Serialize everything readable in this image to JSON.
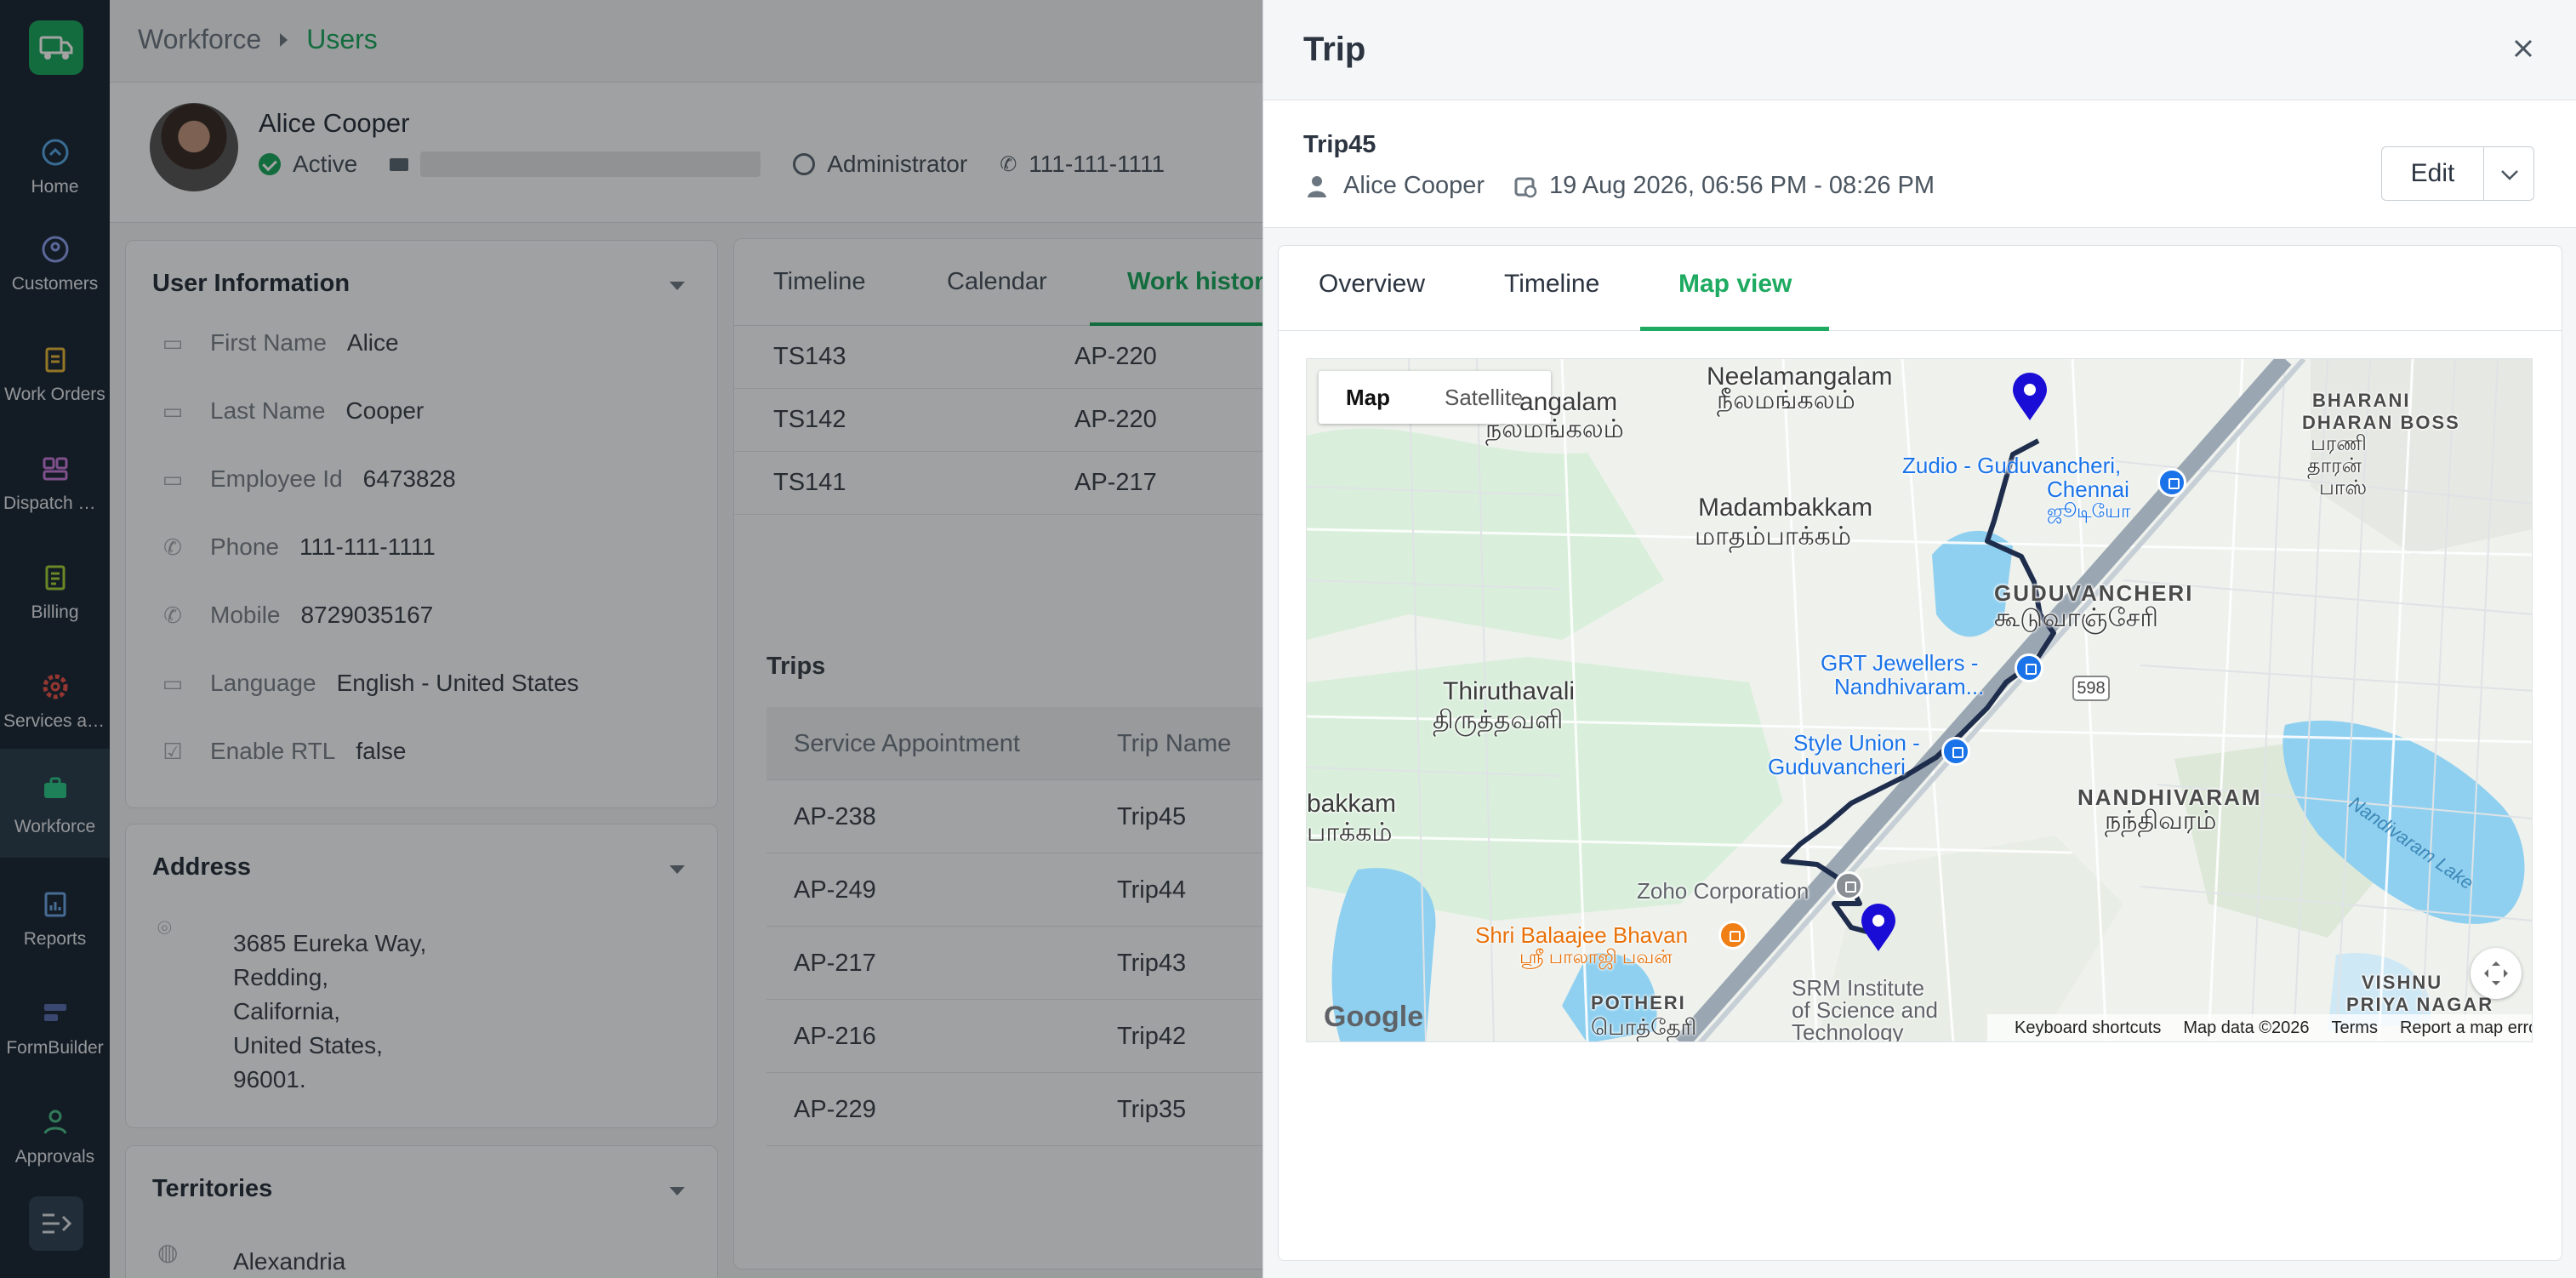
{
  "nav": {
    "items": [
      {
        "label": "Home",
        "icon": "home-icon"
      },
      {
        "label": "Customers",
        "icon": "customers-icon"
      },
      {
        "label": "Work Orders",
        "icon": "work-orders-icon"
      },
      {
        "label": "Dispatch Console",
        "icon": "dispatch-icon"
      },
      {
        "label": "Billing",
        "icon": "billing-icon"
      },
      {
        "label": "Services and Parts",
        "icon": "services-icon"
      },
      {
        "label": "Workforce",
        "icon": "workforce-icon"
      },
      {
        "label": "Reports",
        "icon": "reports-icon"
      },
      {
        "label": "FormBuilder",
        "icon": "formbuilder-icon"
      },
      {
        "label": "Approvals",
        "icon": "approvals-icon"
      }
    ],
    "active": "Workforce",
    "accent": "#1eaa61",
    "background": "#1f2d3b"
  },
  "breadcrumb": {
    "parent": "Workforce",
    "current": "Users"
  },
  "user": {
    "name": "Alice Cooper",
    "status": "Active",
    "role": "Administrator",
    "phone": "111-111-1111"
  },
  "user_info": {
    "title": "User Information",
    "rows": [
      {
        "label": "First Name",
        "value": "Alice"
      },
      {
        "label": "Last Name",
        "value": "Cooper"
      },
      {
        "label": "Employee Id",
        "value": "6473828"
      },
      {
        "label": "Phone",
        "value": "111-111-1111"
      },
      {
        "label": "Mobile",
        "value": "8729035167"
      },
      {
        "label": "Language",
        "value": "English - United States"
      },
      {
        "label": "Enable RTL",
        "value": "false"
      }
    ]
  },
  "address": {
    "title": "Address",
    "lines": [
      "3685 Eureka Way,",
      "Redding,",
      "California,",
      "United States,",
      "96001."
    ]
  },
  "territories": {
    "title": "Territories",
    "first": "Alexandria"
  },
  "work_panel": {
    "tabs": [
      "Timeline",
      "Calendar",
      "Work history"
    ],
    "active_tab": "Work history",
    "timesheets": [
      {
        "id": "TS143",
        "appointment": "AP-220"
      },
      {
        "id": "TS142",
        "appointment": "AP-220"
      },
      {
        "id": "TS141",
        "appointment": "AP-217"
      }
    ],
    "trips_title": "Trips",
    "trips_columns": [
      "Service Appointment",
      "Trip Name"
    ],
    "trips": [
      {
        "appointment": "AP-238",
        "trip": "Trip45"
      },
      {
        "appointment": "AP-249",
        "trip": "Trip44"
      },
      {
        "appointment": "AP-217",
        "trip": "Trip43"
      },
      {
        "appointment": "AP-216",
        "trip": "Trip42"
      },
      {
        "appointment": "AP-229",
        "trip": "Trip35"
      }
    ]
  },
  "drawer": {
    "title": "Trip",
    "trip_name": "Trip45",
    "owner": "Alice Cooper",
    "datetime": "19 Aug 2026, 06:56 PM - 08:26 PM",
    "edit_label": "Edit",
    "tabs": [
      "Overview",
      "Timeline",
      "Map view"
    ],
    "active_tab": "Map view"
  },
  "map": {
    "type_buttons": [
      "Map",
      "Satellite"
    ],
    "selected_type": "Map",
    "labels": {
      "neelamangalam": "Neelamangalam",
      "neelamangalam_ta": "நீலமங்கலம்",
      "nalamangalam_partial": "angalam",
      "nalamangalam_ta": "நலமங்கலம்",
      "madambakkam": "Madambakkam",
      "madambakkam_ta": "மாதம்பாக்கம்",
      "thiruthavali": "Thiruthavali",
      "thiruthavali_ta": "திருத்தவளி",
      "bakkam_partial": "bakkam",
      "bakkam_ta_partial": "பாக்கம்",
      "guduvancheri": "GUDUVANCHERI",
      "guduvancheri_ta": "கூடுவாஞ்சேரி",
      "nandhivaram": "NANDHIVARAM",
      "nandhivaram_ta": "நந்திவரம்",
      "bharani": "BHARANI",
      "bharani2": "DHARAN BOSS",
      "bharani_ta1": "பரணி",
      "bharani_ta2": "தாரன்",
      "bharani_ta3": "பாஸ்",
      "zudio": "Zudio - Guduvancheri,",
      "zudio2": "Chennai",
      "zudio_ta": "ஜூடியோ",
      "grt": "GRT Jewellers -",
      "grt2": "Nandhivaram...",
      "style_union": "Style Union -",
      "style_union2": "Guduvancheri",
      "zoho": "Zoho Corporation",
      "balaajee": "Shri Balaajee Bhavan",
      "balaajee_ta": "ஸ்ரீ பாலாஜி பவன்",
      "srm": "SRM Institute",
      "srm2": "of Science and",
      "srm3": "Technology",
      "potheri": "POTHERI",
      "potheri_ta": "பொத்தேரி",
      "vishnu": "VISHNU",
      "vishnu2": "PRIYA NAGAR",
      "lake": "Nandivaram Lake",
      "route": "598"
    },
    "google": "Google",
    "attribution": [
      "Keyboard shortcuts",
      "Map data ©2026",
      "Terms",
      "Report a map error"
    ]
  }
}
